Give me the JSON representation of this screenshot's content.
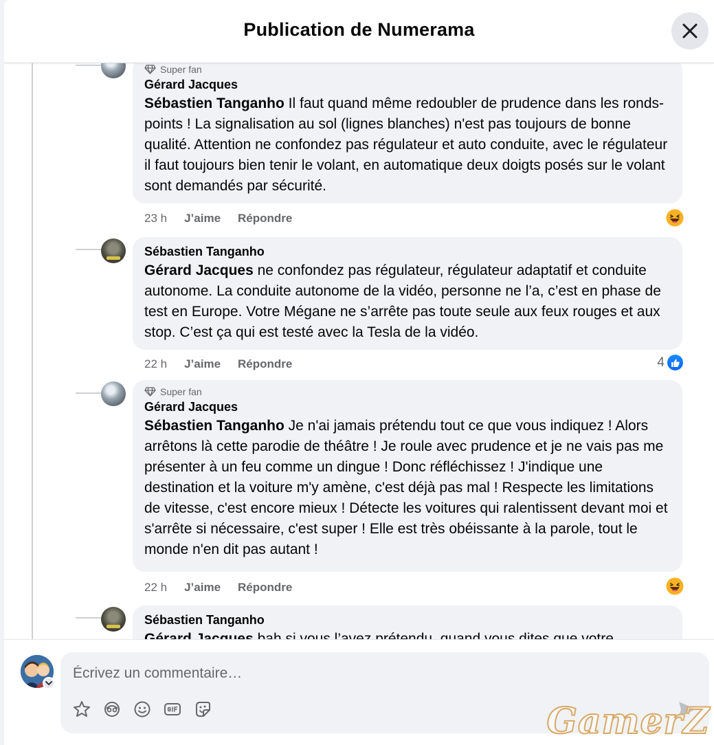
{
  "header": {
    "title": "Publication de Numerama"
  },
  "comments": [
    {
      "badge": "Super fan",
      "author": "Gérard Jacques",
      "mention": "Sébastien Tanganho",
      "text": " Il faut quand même redoubler de prudence dans les ronds-points ! La signalisation au sol (lignes blanches) n'est pas toujours de bonne qualité. Attention ne confondez pas régulateur et auto conduite, avec le régulateur il faut toujours bien tenir le volant, en automatique deux doigts posés sur le volant sont demandés par sécurité.",
      "time": "23 h",
      "like": "J’aime",
      "reply": "Répondre",
      "reaction": "haha"
    },
    {
      "author": "Sébastien Tanganho",
      "mention": "Gérard Jacques",
      "text": " ne confondez pas régulateur, régulateur adaptatif et conduite autonome. La conduite autonome de la vidéo, personne ne l’a, c’est en phase de test en Europe. Votre Mégane ne s’arrête pas toute seule aux feux rouges et aux stop. C’est ça qui est testé avec la Tesla de la vidéo.",
      "time": "22 h",
      "like": "J’aime",
      "reply": "Répondre",
      "reaction": "like",
      "reaction_count": "4"
    },
    {
      "badge": "Super fan",
      "author": "Gérard Jacques",
      "mention": "Sébastien Tanganho",
      "text": " Je n'ai jamais prétendu tout ce que vous indiquez ! Alors arrêtons là cette parodie de théâtre ! Je roule avec prudence et je ne vais pas me présenter à un feu comme un dingue ! Donc réfléchissez ! J'indique une destination et la voiture m'y amène, c'est déjà pas mal ! Respecte les limitations de vitesse, c'est encore mieux ! Détecte les voitures qui ralentissent devant moi et s'arrête si nécessaire, c'est super ! Elle est très obéissante à la parole, tout le monde n'en dit pas autant !",
      "time": "22 h",
      "like": "J’aime",
      "reply": "Répondre",
      "reaction": "haha"
    },
    {
      "author": "Sébastien Tanganho",
      "mention": "Gérard Jacques",
      "text": " bah si vous l’avez prétendu, quand vous dites que votre"
    }
  ],
  "composer": {
    "placeholder": "Écrivez un commentaire…",
    "tools": [
      "sticker-icon",
      "avatar-sticker-icon",
      "emoji-icon",
      "gif-icon",
      "sticker-face-icon"
    ]
  },
  "watermark": "GamerZ",
  "colors": {
    "like_blue": "#0866ff",
    "bubble": "#f0f2f5",
    "meta": "#65676b"
  }
}
